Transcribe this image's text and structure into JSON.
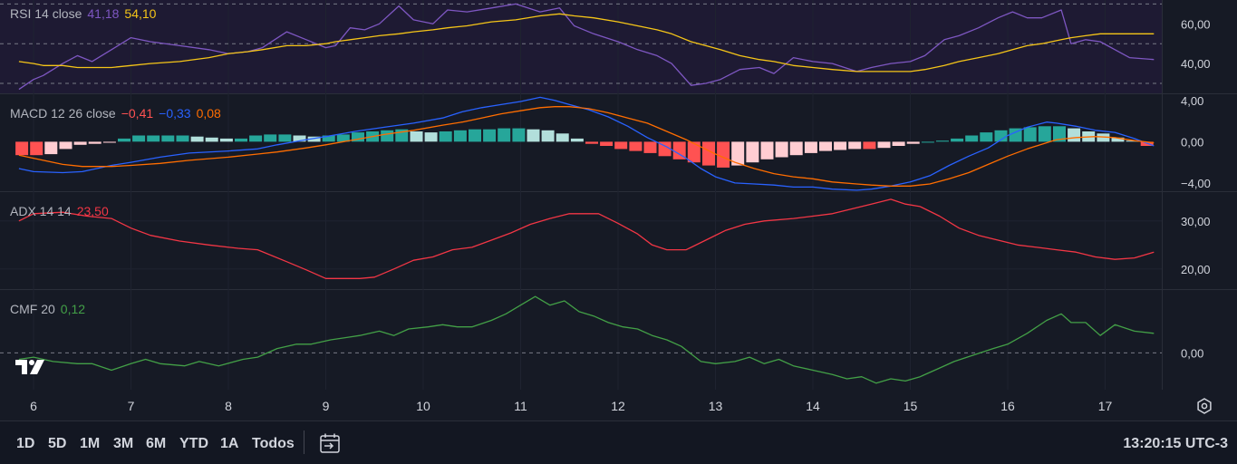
{
  "colors": {
    "rsi": "#7e57c2",
    "rsi_ma": "#f5c518",
    "macd": "#2962ff",
    "signal": "#ff6d00",
    "hist_up_strong": "#26a69a",
    "hist_up_weak": "#b2dfdb",
    "hist_down_strong": "#ff5252",
    "hist_down_weak": "#ffcdd2",
    "adx": "#f23645",
    "cmf": "#43a047",
    "axis_text": "#d1d4dc",
    "grid": "#2a2e39"
  },
  "legends": {
    "rsi": {
      "name": "RSI 14 close",
      "v1": "41,18",
      "v2": "54,10"
    },
    "macd": {
      "name": "MACD 12 26 close",
      "v1": "−0,41",
      "v2": "−0,33",
      "v3": "0,08"
    },
    "adx": {
      "name": "ADX 14 14",
      "v1": "23,50"
    },
    "cmf": {
      "name": "CMF 20",
      "v1": "0,12"
    }
  },
  "footer": {
    "timeframes": [
      "1D",
      "5D",
      "1M",
      "3M",
      "6M",
      "YTD",
      "1A",
      "Todos"
    ],
    "clock": "13:20:15 UTC-3"
  },
  "icons": [
    "tradingview-logo-icon",
    "calendar-range-icon",
    "settings-gear-icon"
  ],
  "chart_data": [
    {
      "type": "line",
      "panel": "RSI 14 close",
      "x_ticks": [
        "6",
        "7",
        "8",
        "9",
        "10",
        "11",
        "12",
        "13",
        "14",
        "15",
        "16",
        "17"
      ],
      "x": [
        5.85,
        6.0,
        6.1,
        6.3,
        6.45,
        6.6,
        6.8,
        7.0,
        7.2,
        7.5,
        7.8,
        8.0,
        8.2,
        8.35,
        8.6,
        8.8,
        9.0,
        9.1,
        9.25,
        9.4,
        9.55,
        9.75,
        9.9,
        10.1,
        10.25,
        10.45,
        10.7,
        10.95,
        11.2,
        11.4,
        11.55,
        11.75,
        12.0,
        12.2,
        12.4,
        12.55,
        12.75,
        12.9,
        13.05,
        13.25,
        13.45,
        13.6,
        13.8,
        14.0,
        14.2,
        14.45,
        14.6,
        14.8,
        15.0,
        15.15,
        15.35,
        15.5,
        15.7,
        15.9,
        16.05,
        16.2,
        16.35,
        16.55,
        16.65,
        16.8,
        16.95,
        17.1,
        17.25,
        17.5
      ],
      "series": [
        {
          "name": "RSI",
          "values": [
            27,
            32,
            34,
            40,
            44,
            41,
            47,
            53,
            51,
            49,
            47,
            45,
            46,
            48,
            56,
            52,
            48,
            49,
            58,
            57,
            60,
            69,
            62,
            60,
            67,
            66,
            68,
            70,
            66,
            68,
            59,
            55,
            51,
            47,
            44,
            40,
            29,
            30,
            32,
            37,
            38,
            35,
            43,
            41,
            40,
            36,
            38,
            40,
            41,
            44,
            52,
            54,
            58,
            63,
            66,
            63,
            63,
            67,
            50,
            52,
            51,
            47,
            43,
            42
          ]
        },
        {
          "name": "RSI MA",
          "values": [
            41,
            40,
            39,
            39,
            38,
            38,
            38,
            39,
            40,
            41,
            43,
            45,
            46,
            47,
            49,
            49,
            50,
            51,
            52,
            53,
            54,
            55,
            56,
            57,
            58,
            59,
            61,
            62,
            64,
            65,
            64,
            63,
            61,
            59,
            57,
            55,
            51,
            49,
            47,
            44,
            42,
            41,
            39,
            38,
            37,
            36,
            36,
            36,
            36,
            37,
            39,
            41,
            43,
            45,
            47,
            49,
            50,
            52,
            53,
            54,
            55,
            55,
            55,
            55
          ]
        }
      ],
      "y_ticks": [
        "60,00",
        "40,00"
      ],
      "ylim": [
        25,
        72
      ],
      "bands": [
        30,
        50,
        70
      ]
    },
    {
      "type": "line+bar",
      "panel": "MACD 12 26 close",
      "x_ticks": [
        "6",
        "7",
        "8",
        "9",
        "10",
        "11",
        "12",
        "13",
        "14",
        "15",
        "16",
        "17"
      ],
      "x": [
        5.85,
        6.0,
        6.3,
        6.5,
        6.8,
        7.0,
        7.3,
        7.6,
        8.0,
        8.3,
        8.5,
        8.8,
        9.0,
        9.3,
        9.6,
        9.9,
        10.2,
        10.4,
        10.6,
        10.8,
        11.0,
        11.2,
        11.35,
        11.5,
        11.7,
        11.9,
        12.1,
        12.3,
        12.5,
        12.7,
        12.85,
        13.0,
        13.2,
        13.4,
        13.6,
        13.8,
        14.0,
        14.2,
        14.45,
        14.6,
        14.8,
        15.0,
        15.2,
        15.4,
        15.6,
        15.8,
        16.0,
        16.2,
        16.4,
        16.5,
        16.7,
        16.9,
        17.1,
        17.3,
        17.5
      ],
      "series": [
        {
          "name": "MACD",
          "values": [
            -2.6,
            -2.9,
            -3.0,
            -2.9,
            -2.3,
            -2.0,
            -1.5,
            -1.1,
            -0.9,
            -0.7,
            -0.3,
            0.2,
            0.5,
            1.0,
            1.4,
            1.8,
            2.3,
            2.9,
            3.3,
            3.6,
            3.9,
            4.3,
            4.0,
            3.6,
            3.1,
            2.4,
            1.5,
            0.4,
            -0.5,
            -1.6,
            -2.6,
            -3.4,
            -4.0,
            -4.1,
            -4.2,
            -4.4,
            -4.4,
            -4.6,
            -4.7,
            -4.6,
            -4.3,
            -3.9,
            -3.3,
            -2.3,
            -1.4,
            -0.6,
            0.6,
            1.4,
            1.9,
            1.8,
            1.5,
            1.1,
            0.9,
            0.3,
            -0.4
          ]
        },
        {
          "name": "Signal",
          "values": [
            -1.3,
            -1.6,
            -2.2,
            -2.4,
            -2.4,
            -2.3,
            -2.1,
            -1.8,
            -1.5,
            -1.2,
            -1.0,
            -0.6,
            -0.3,
            0.2,
            0.7,
            1.1,
            1.6,
            1.9,
            2.3,
            2.7,
            3.0,
            3.3,
            3.4,
            3.4,
            3.2,
            2.8,
            2.3,
            1.8,
            1.0,
            0.2,
            -0.5,
            -1.2,
            -2.0,
            -2.6,
            -3.1,
            -3.4,
            -3.6,
            -3.9,
            -4.1,
            -4.2,
            -4.3,
            -4.3,
            -4.1,
            -3.6,
            -3.0,
            -2.2,
            -1.4,
            -0.7,
            -0.1,
            0.2,
            0.4,
            0.5,
            0.4,
            0.1,
            -0.1
          ]
        }
      ],
      "histogram": {
        "x": [
          5.88,
          6.03,
          6.18,
          6.33,
          6.48,
          6.63,
          6.78,
          6.93,
          7.08,
          7.23,
          7.38,
          7.53,
          7.68,
          7.83,
          7.98,
          8.13,
          8.28,
          8.43,
          8.58,
          8.73,
          8.88,
          9.03,
          9.18,
          9.33,
          9.48,
          9.63,
          9.78,
          9.93,
          10.08,
          10.23,
          10.38,
          10.53,
          10.68,
          10.83,
          10.98,
          11.13,
          11.28,
          11.43,
          11.58,
          11.73,
          11.88,
          12.03,
          12.18,
          12.33,
          12.48,
          12.63,
          12.78,
          12.93,
          13.08,
          13.23,
          13.38,
          13.53,
          13.68,
          13.83,
          13.98,
          14.13,
          14.28,
          14.43,
          14.58,
          14.73,
          14.88,
          15.03,
          15.18,
          15.33,
          15.48,
          15.63,
          15.78,
          15.93,
          16.08,
          16.23,
          16.38,
          16.53,
          16.68,
          16.83,
          16.98,
          17.13,
          17.28,
          17.43
        ],
        "values": [
          -1.3,
          -1.3,
          -1.2,
          -0.7,
          -0.3,
          -0.2,
          -0.1,
          0.3,
          0.6,
          0.6,
          0.6,
          0.6,
          0.5,
          0.4,
          0.3,
          0.3,
          0.6,
          0.7,
          0.7,
          0.6,
          0.5,
          0.6,
          0.7,
          0.9,
          1.0,
          1.1,
          1.2,
          1.0,
          0.9,
          1.0,
          1.1,
          1.2,
          1.2,
          1.3,
          1.3,
          1.2,
          1.1,
          0.8,
          0.3,
          -0.2,
          -0.4,
          -0.7,
          -0.9,
          -1.1,
          -1.4,
          -1.7,
          -2.0,
          -2.3,
          -2.5,
          -2.3,
          -2.0,
          -1.7,
          -1.5,
          -1.3,
          -1.1,
          -0.9,
          -0.8,
          -0.7,
          -0.7,
          -0.6,
          -0.4,
          -0.2,
          0.0,
          0.1,
          0.3,
          0.6,
          0.9,
          1.1,
          1.3,
          1.4,
          1.5,
          1.5,
          1.3,
          1.0,
          0.8,
          0.4,
          0.1,
          -0.4
        ]
      },
      "y_ticks": [
        "4,00",
        "0,00",
        "−4,00"
      ],
      "ylim": [
        -4.8,
        4.6
      ]
    },
    {
      "type": "line",
      "panel": "ADX 14 14",
      "x_ticks": [
        "6",
        "7",
        "8",
        "9",
        "10",
        "11",
        "12",
        "13",
        "14",
        "15",
        "16",
        "17"
      ],
      "x": [
        5.85,
        6.0,
        6.3,
        6.55,
        6.8,
        7.0,
        7.2,
        7.5,
        7.8,
        8.1,
        8.3,
        8.6,
        8.8,
        9.0,
        9.2,
        9.35,
        9.5,
        9.7,
        9.9,
        10.1,
        10.3,
        10.5,
        10.7,
        10.9,
        11.1,
        11.3,
        11.5,
        11.8,
        12.0,
        12.2,
        12.35,
        12.5,
        12.7,
        12.9,
        13.1,
        13.3,
        13.5,
        13.8,
        14.0,
        14.2,
        14.4,
        14.6,
        14.8,
        14.95,
        15.1,
        15.3,
        15.5,
        15.7,
        15.9,
        16.1,
        16.3,
        16.5,
        16.7,
        16.9,
        17.1,
        17.3,
        17.5
      ],
      "series": [
        {
          "name": "ADX",
          "values": [
            30,
            31.5,
            31.8,
            31,
            30.5,
            28.5,
            27,
            25.8,
            25,
            24.3,
            24,
            21.5,
            19.8,
            18,
            18,
            18,
            18.3,
            20,
            21.8,
            22.5,
            24,
            24.5,
            26,
            27.5,
            29.3,
            30.5,
            31.5,
            31.5,
            29.5,
            27.3,
            25,
            24,
            24,
            26,
            28,
            29.3,
            30,
            30.5,
            31,
            31.5,
            32.5,
            33.5,
            34.5,
            33.5,
            33,
            31,
            28.5,
            27,
            26,
            25,
            24.5,
            24,
            23.5,
            22.5,
            22,
            22.3,
            23.5
          ]
        }
      ],
      "y_ticks": [
        "30,00",
        "20,00"
      ],
      "ylim": [
        15.8,
        36
      ]
    },
    {
      "type": "line",
      "panel": "CMF 20",
      "x_ticks": [
        "6",
        "7",
        "8",
        "9",
        "10",
        "11",
        "12",
        "13",
        "14",
        "15",
        "16",
        "17"
      ],
      "x": [
        5.85,
        6.0,
        6.2,
        6.45,
        6.6,
        6.8,
        7.0,
        7.15,
        7.3,
        7.55,
        7.7,
        7.9,
        8.15,
        8.3,
        8.5,
        8.7,
        8.85,
        9.05,
        9.2,
        9.35,
        9.55,
        9.7,
        9.85,
        10.05,
        10.2,
        10.35,
        10.5,
        10.7,
        10.85,
        11.0,
        11.15,
        11.3,
        11.45,
        11.6,
        11.75,
        11.9,
        12.05,
        12.2,
        12.35,
        12.5,
        12.65,
        12.85,
        13.0,
        13.2,
        13.35,
        13.5,
        13.65,
        13.8,
        14.0,
        14.2,
        14.35,
        14.5,
        14.65,
        14.8,
        14.95,
        15.1,
        15.3,
        15.45,
        15.65,
        15.85,
        16.0,
        16.2,
        16.4,
        16.55,
        16.65,
        16.8,
        16.95,
        17.1,
        17.3,
        17.5
      ],
      "series": [
        {
          "name": "CMF",
          "values": [
            -0.03,
            -0.02,
            -0.04,
            -0.05,
            -0.05,
            -0.08,
            -0.05,
            -0.03,
            -0.05,
            -0.06,
            -0.04,
            -0.06,
            -0.03,
            -0.02,
            0.02,
            0.04,
            0.04,
            0.06,
            0.07,
            0.08,
            0.1,
            0.08,
            0.11,
            0.12,
            0.13,
            0.12,
            0.12,
            0.15,
            0.18,
            0.22,
            0.26,
            0.22,
            0.24,
            0.19,
            0.17,
            0.14,
            0.12,
            0.11,
            0.08,
            0.06,
            0.03,
            -0.04,
            -0.05,
            -0.04,
            -0.02,
            -0.05,
            -0.03,
            -0.06,
            -0.08,
            -0.1,
            -0.12,
            -0.11,
            -0.14,
            -0.12,
            -0.13,
            -0.11,
            -0.07,
            -0.04,
            -0.01,
            0.02,
            0.04,
            0.09,
            0.15,
            0.18,
            0.14,
            0.14,
            0.08,
            0.13,
            0.1,
            0.09
          ]
        }
      ],
      "y_ticks": [
        "0,00"
      ],
      "ylim": [
        -0.17,
        0.29
      ]
    }
  ]
}
